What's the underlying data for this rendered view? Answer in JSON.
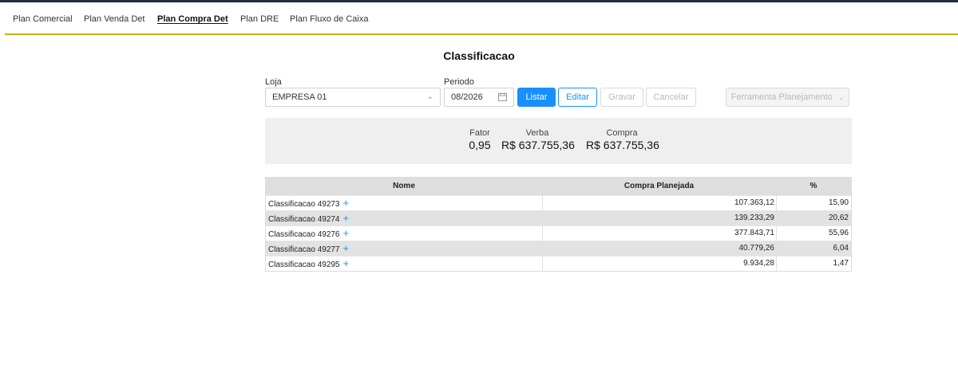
{
  "tabs": [
    {
      "label": "Plan Comercial"
    },
    {
      "label": "Plan Venda Det"
    },
    {
      "label": "Plan Compra Det"
    },
    {
      "label": "Plan DRE"
    },
    {
      "label": "Plan Fluxo de Caixa"
    }
  ],
  "active_tab": "Plan Compra Det",
  "page_title": "Classificacao",
  "filters": {
    "loja_label": "Loja",
    "loja_value": "EMPRESA 01",
    "periodo_label": "Periodo",
    "periodo_value": "08/2026"
  },
  "buttons": {
    "listar": "Listar",
    "editar": "Editar",
    "gravar": "Gravar",
    "cancelar": "Cancelar",
    "ferramenta": "Ferramenta Planejamento"
  },
  "summary": {
    "fator_label": "Fator",
    "fator_value": "0,95",
    "verba_label": "Verba",
    "verba_value": "R$ 637.755,36",
    "compra_label": "Compra",
    "compra_value": "R$ 637.755,36"
  },
  "table": {
    "headers": {
      "nome": "Nome",
      "compra": "Compra Planejada",
      "pct": "%"
    },
    "rows": [
      {
        "nome": "Classificacao 49273",
        "compra": "107.363,12",
        "pct": "15,90"
      },
      {
        "nome": "Classificacao 49274",
        "compra": "139.233,29",
        "pct": "20,62"
      },
      {
        "nome": "Classificacao 49276",
        "compra": "377.843,71",
        "pct": "55,96"
      },
      {
        "nome": "Classificacao 49277",
        "compra": "40.779,26",
        "pct": "6,04"
      },
      {
        "nome": "Classificacao 49295",
        "compra": "9.934,28",
        "pct": "1,47"
      }
    ]
  },
  "colors": {
    "accent": "#1890ff",
    "tab_rule": "#c8b400",
    "top_bar": "#1f2d3d"
  }
}
